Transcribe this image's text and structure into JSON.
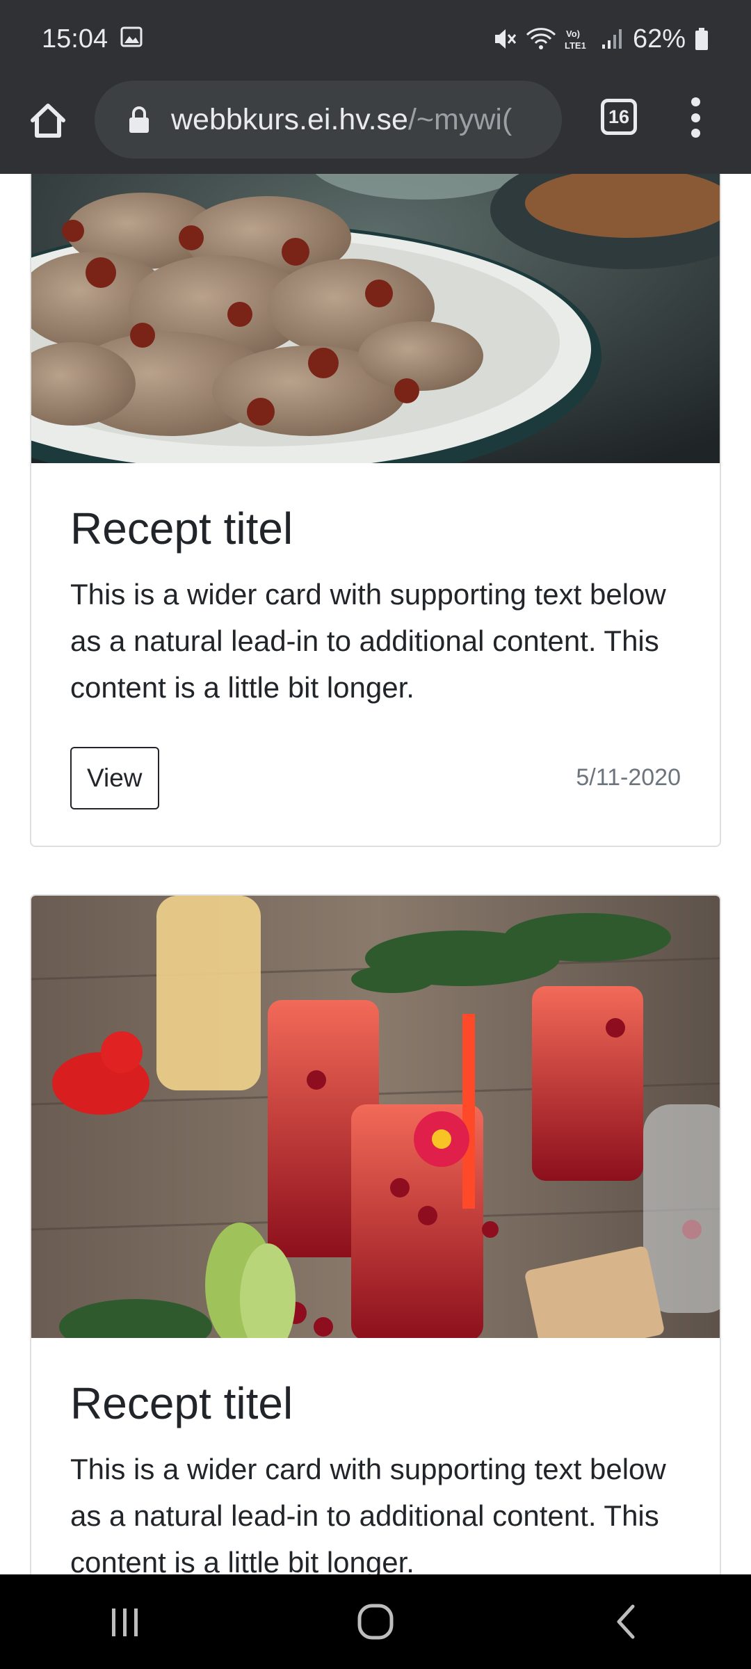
{
  "status_bar": {
    "time": "15:04",
    "battery_percent": "62%",
    "icons": [
      "gallery-icon",
      "vibrate-mute-icon",
      "wifi-icon",
      "volte-icon",
      "signal-icon",
      "battery-icon"
    ]
  },
  "browser": {
    "url_host": "webbkurs.ei.hv.se",
    "url_path": "/~mywi(",
    "tab_count": "16"
  },
  "cards": [
    {
      "image": "cookies-photo",
      "title": "Recept titel",
      "text": "This is a wider card with supporting text below as a natural lead-in to additional content. This content is a little bit longer.",
      "button_label": "View",
      "date": "5/11-2020"
    },
    {
      "image": "drinks-photo",
      "title": "Recept titel",
      "text": "This is a wider card with supporting text below as a natural lead-in to additional content. This content is a little bit longer."
    }
  ],
  "nav_bar": {
    "icons": [
      "recent-apps-icon",
      "home-circle-icon",
      "back-icon"
    ]
  }
}
